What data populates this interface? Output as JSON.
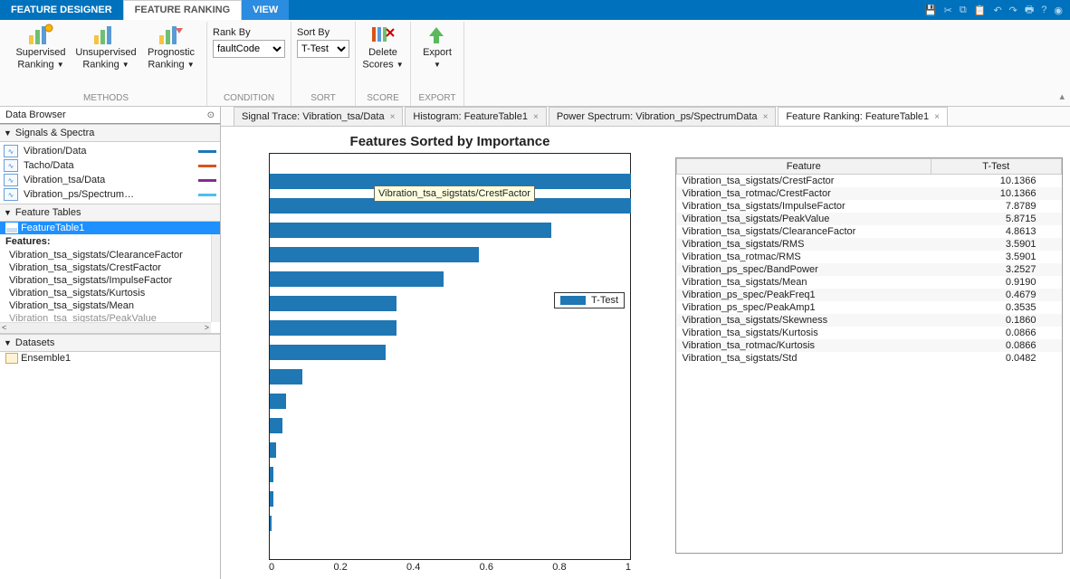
{
  "topTabs": {
    "designer": "FEATURE DESIGNER",
    "ranking": "FEATURE RANKING",
    "view": "VIEW"
  },
  "ribbon": {
    "supervised": "Supervised\nRanking",
    "unsupervised": "Unsupervised\nRanking",
    "prognostic": "Prognostic\nRanking",
    "cond_rankby": "Rank By",
    "cond_value": "faultCode",
    "sort_by": "Sort By",
    "sort_value": "T-Test",
    "delete": "Delete\nScores",
    "export": "Export",
    "groups": {
      "methods": "METHODS",
      "condition": "CONDITION",
      "sort": "SORT",
      "score": "SCORE",
      "export": "EXPORT"
    }
  },
  "sidebar": {
    "title": "Data Browser",
    "signals_hdr": "Signals & Spectra",
    "signals": [
      {
        "name": "Vibration/Data",
        "color": "#1f77b4"
      },
      {
        "name": "Tacho/Data",
        "color": "#d95319"
      },
      {
        "name": "Vibration_tsa/Data",
        "color": "#7e2f8e"
      },
      {
        "name": "Vibration_ps/Spectrum…",
        "color": "#4dbeee"
      }
    ],
    "ftables_hdr": "Feature Tables",
    "ftable_selected": "FeatureTable1",
    "features_label": "Features:",
    "features": [
      "Vibration_tsa_sigstats/ClearanceFactor",
      "Vibration_tsa_sigstats/CrestFactor",
      "Vibration_tsa_sigstats/ImpulseFactor",
      "Vibration_tsa_sigstats/Kurtosis",
      "Vibration_tsa_sigstats/Mean",
      "Vibration_tsa_sigstats/PeakValue"
    ],
    "datasets_hdr": "Datasets",
    "dataset": "Ensemble1"
  },
  "doctabs": [
    "Signal Trace: Vibration_tsa/Data",
    "Histogram: FeatureTable1",
    "Power Spectrum: Vibration_ps/SpectrumData",
    "Feature Ranking: FeatureTable1"
  ],
  "chart_data": {
    "type": "bar",
    "title": "Features Sorted by Importance",
    "xlabel": "",
    "ylabel": "",
    "xlim": [
      0,
      1
    ],
    "xticks": [
      0,
      0.2,
      0.4,
      0.6,
      0.8,
      1
    ],
    "legend": "T-Test",
    "tooltip": "Vibration_tsa_sigstats/CrestFactor",
    "values_normalized": [
      1.0,
      1.0,
      0.78,
      0.58,
      0.48,
      0.35,
      0.35,
      0.32,
      0.09,
      0.046,
      0.035,
      0.018,
      0.009,
      0.009,
      0.005
    ]
  },
  "ranking": {
    "col_feature": "Feature",
    "col_score": "T-Test",
    "rows": [
      {
        "f": "Vibration_tsa_sigstats/CrestFactor",
        "s": "10.1366"
      },
      {
        "f": "Vibration_tsa_rotmac/CrestFactor",
        "s": "10.1366"
      },
      {
        "f": "Vibration_tsa_sigstats/ImpulseFactor",
        "s": "7.8789"
      },
      {
        "f": "Vibration_tsa_sigstats/PeakValue",
        "s": "5.8715"
      },
      {
        "f": "Vibration_tsa_sigstats/ClearanceFactor",
        "s": "4.8613"
      },
      {
        "f": "Vibration_tsa_sigstats/RMS",
        "s": "3.5901"
      },
      {
        "f": "Vibration_tsa_rotmac/RMS",
        "s": "3.5901"
      },
      {
        "f": "Vibration_ps_spec/BandPower",
        "s": "3.2527"
      },
      {
        "f": "Vibration_tsa_sigstats/Mean",
        "s": "0.9190"
      },
      {
        "f": "Vibration_ps_spec/PeakFreq1",
        "s": "0.4679"
      },
      {
        "f": "Vibration_ps_spec/PeakAmp1",
        "s": "0.3535"
      },
      {
        "f": "Vibration_tsa_sigstats/Skewness",
        "s": "0.1860"
      },
      {
        "f": "Vibration_tsa_sigstats/Kurtosis",
        "s": "0.0866"
      },
      {
        "f": "Vibration_tsa_rotmac/Kurtosis",
        "s": "0.0866"
      },
      {
        "f": "Vibration_tsa_sigstats/Std",
        "s": "0.0482"
      }
    ]
  }
}
